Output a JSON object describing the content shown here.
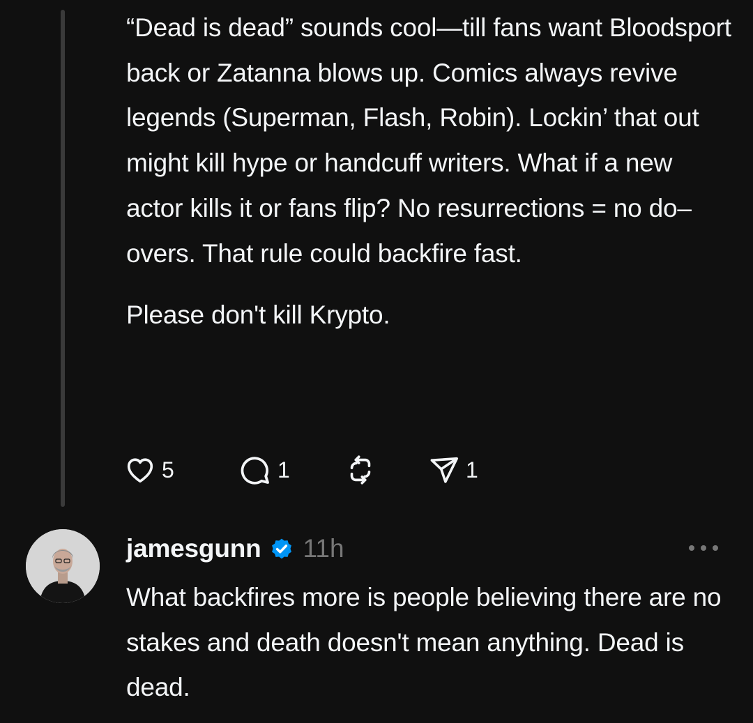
{
  "parent_post": {
    "paragraphs": [
      "“Dead is dead” sounds cool—till fans want Bloodsport back or Zatanna blows up. Comics always revive legends (Superman, Flash, Robin). Lockin’ that out might kill hype or handcuff writers. What if a new actor kills it or fans flip? No resurrections = no do–overs. That rule could backfire fast.",
      "Please don't kill Krypto."
    ],
    "actions": {
      "like_count": "5",
      "reply_count": "1",
      "repost_count": "",
      "share_count": "1",
      "like_icon": "heart-icon",
      "reply_icon": "comment-bubble-icon",
      "repost_icon": "repost-icon",
      "share_icon": "paper-plane-icon"
    }
  },
  "reply": {
    "username": "jamesgunn",
    "verified": true,
    "timestamp": "11h",
    "avatar_icon": "user-avatar",
    "more_icon": "more-horizontal-icon",
    "text": "What backfires more is people believing there are no stakes and death doesn't mean anything. Dead is dead."
  },
  "colors": {
    "background": "#101010",
    "text": "#f3f5f7",
    "muted": "#777777",
    "thread_line": "#3a3a3a",
    "verified_badge": "#0095f6"
  }
}
